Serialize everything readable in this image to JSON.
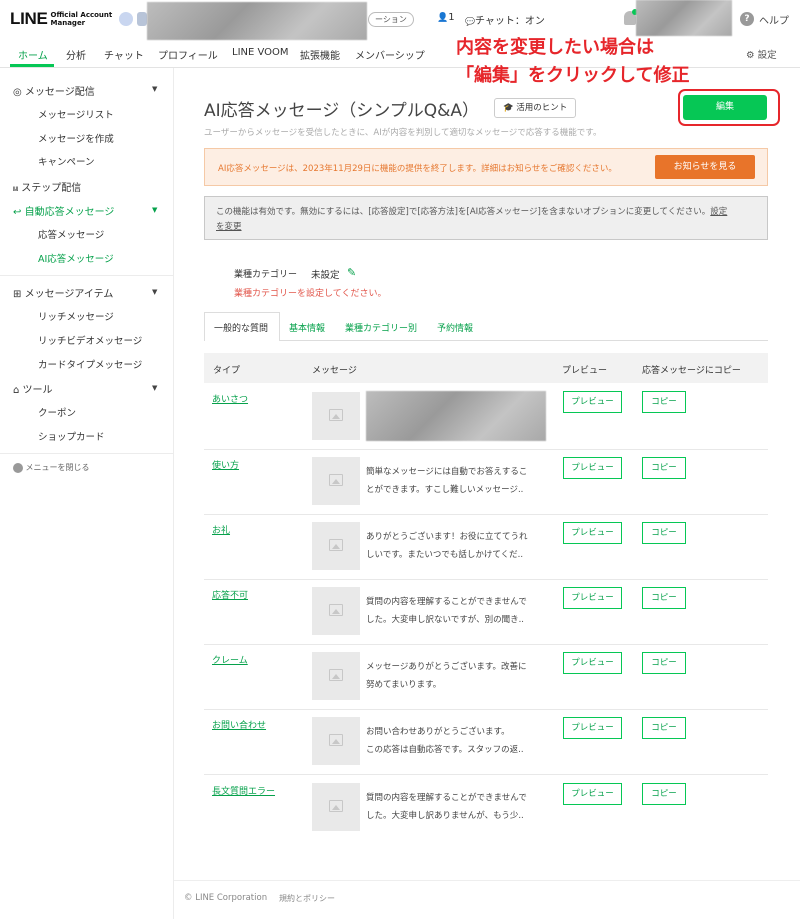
{
  "header": {
    "logo_main": "LINE",
    "logo_sub_line1": "Official Account",
    "logo_sub_line2": "Manager",
    "account_status_pill": "ーション",
    "member_count": "1",
    "chat_status": "チャット：オン",
    "help": "ヘルプ"
  },
  "nav": {
    "items": [
      "ホーム",
      "分析",
      "チャット",
      "プロフィール",
      "LINE VOOM",
      "拡張機能",
      "メンバーシップ"
    ],
    "settings": "設定"
  },
  "sidebar": {
    "message_delivery": "メッセージ配信",
    "message_list": "メッセージリスト",
    "create_message": "メッセージを作成",
    "campaign": "キャンペーン",
    "step_delivery": "ステップ配信",
    "auto_reply": "自動応答メッセージ",
    "reply_message": "応答メッセージ",
    "ai_reply": "AI応答メッセージ",
    "message_items": "メッセージアイテム",
    "rich_message": "リッチメッセージ",
    "rich_video": "リッチビデオメッセージ",
    "card_type": "カードタイプメッセージ",
    "tools": "ツール",
    "coupon": "クーポン",
    "shop_card": "ショップカード",
    "close_menu": "メニューを閉じる"
  },
  "main": {
    "title": "AI応答メッセージ（シンプルQ&A）",
    "hint_button": "活用のヒント",
    "description": "ユーザーからメッセージを受信したときに、AIが内容を判別して適切なメッセージで応答する機能です。",
    "edit_button": "編集",
    "annotation_line1": "内容を変更したい場合は",
    "annotation_line2": "「編集」をクリックして修正",
    "warning_text": "AI応答メッセージは、2023年11月29日に機能の提供を終了します。詳細はお知らせをご確認ください。",
    "warning_button": "お知らせを見る",
    "info_text": "この機能は有効です。無効にするには、[応答設定]で[応答方法]を[AI応答メッセージ]を含まないオプションに変更してください。",
    "info_link1": "設定",
    "info_link2": "を変更",
    "category_label": "業種カテゴリー",
    "category_value": "未設定",
    "category_warning": "業種カテゴリーを設定してください。",
    "tabs": [
      "一般的な質問",
      "基本情報",
      "業種カテゴリー別",
      "予約情報"
    ],
    "table_headers": [
      "タイプ",
      "メッセージ",
      "プレビュー",
      "応答メッセージにコピー"
    ],
    "preview_label": "プレビュー",
    "copy_label": "コピー",
    "rows": [
      {
        "type": "あいさつ",
        "line1": "",
        "line2": ""
      },
      {
        "type": "使い方",
        "line1": "簡単なメッセージには自動でお答えするこ",
        "line2": "とができます。すこし難しいメッセージ.."
      },
      {
        "type": "お礼",
        "line1": "ありがとうございます！お役に立ててうれ",
        "line2": "しいです。またいつでも話しかけてくだ.."
      },
      {
        "type": "応答不可",
        "line1": "質問の内容を理解することができませんで",
        "line2": "した。大変申し訳ないですが、別の聞き.."
      },
      {
        "type": "クレーム",
        "line1": "メッセージありがとうございます。改善に",
        "line2": "努めてまいります。"
      },
      {
        "type": "お問い合わせ",
        "line1": "お問い合わせありがとうございます。",
        "line2": "この応答は自動応答です。スタッフの返.."
      },
      {
        "type": "長文質問エラー",
        "line1": "質問の内容を理解することができませんで",
        "line2": "した。大変申し訳ありませんが、もう少.."
      }
    ]
  },
  "footer": {
    "copyright": "© LINE Corporation",
    "policy": "規約とポリシー"
  }
}
